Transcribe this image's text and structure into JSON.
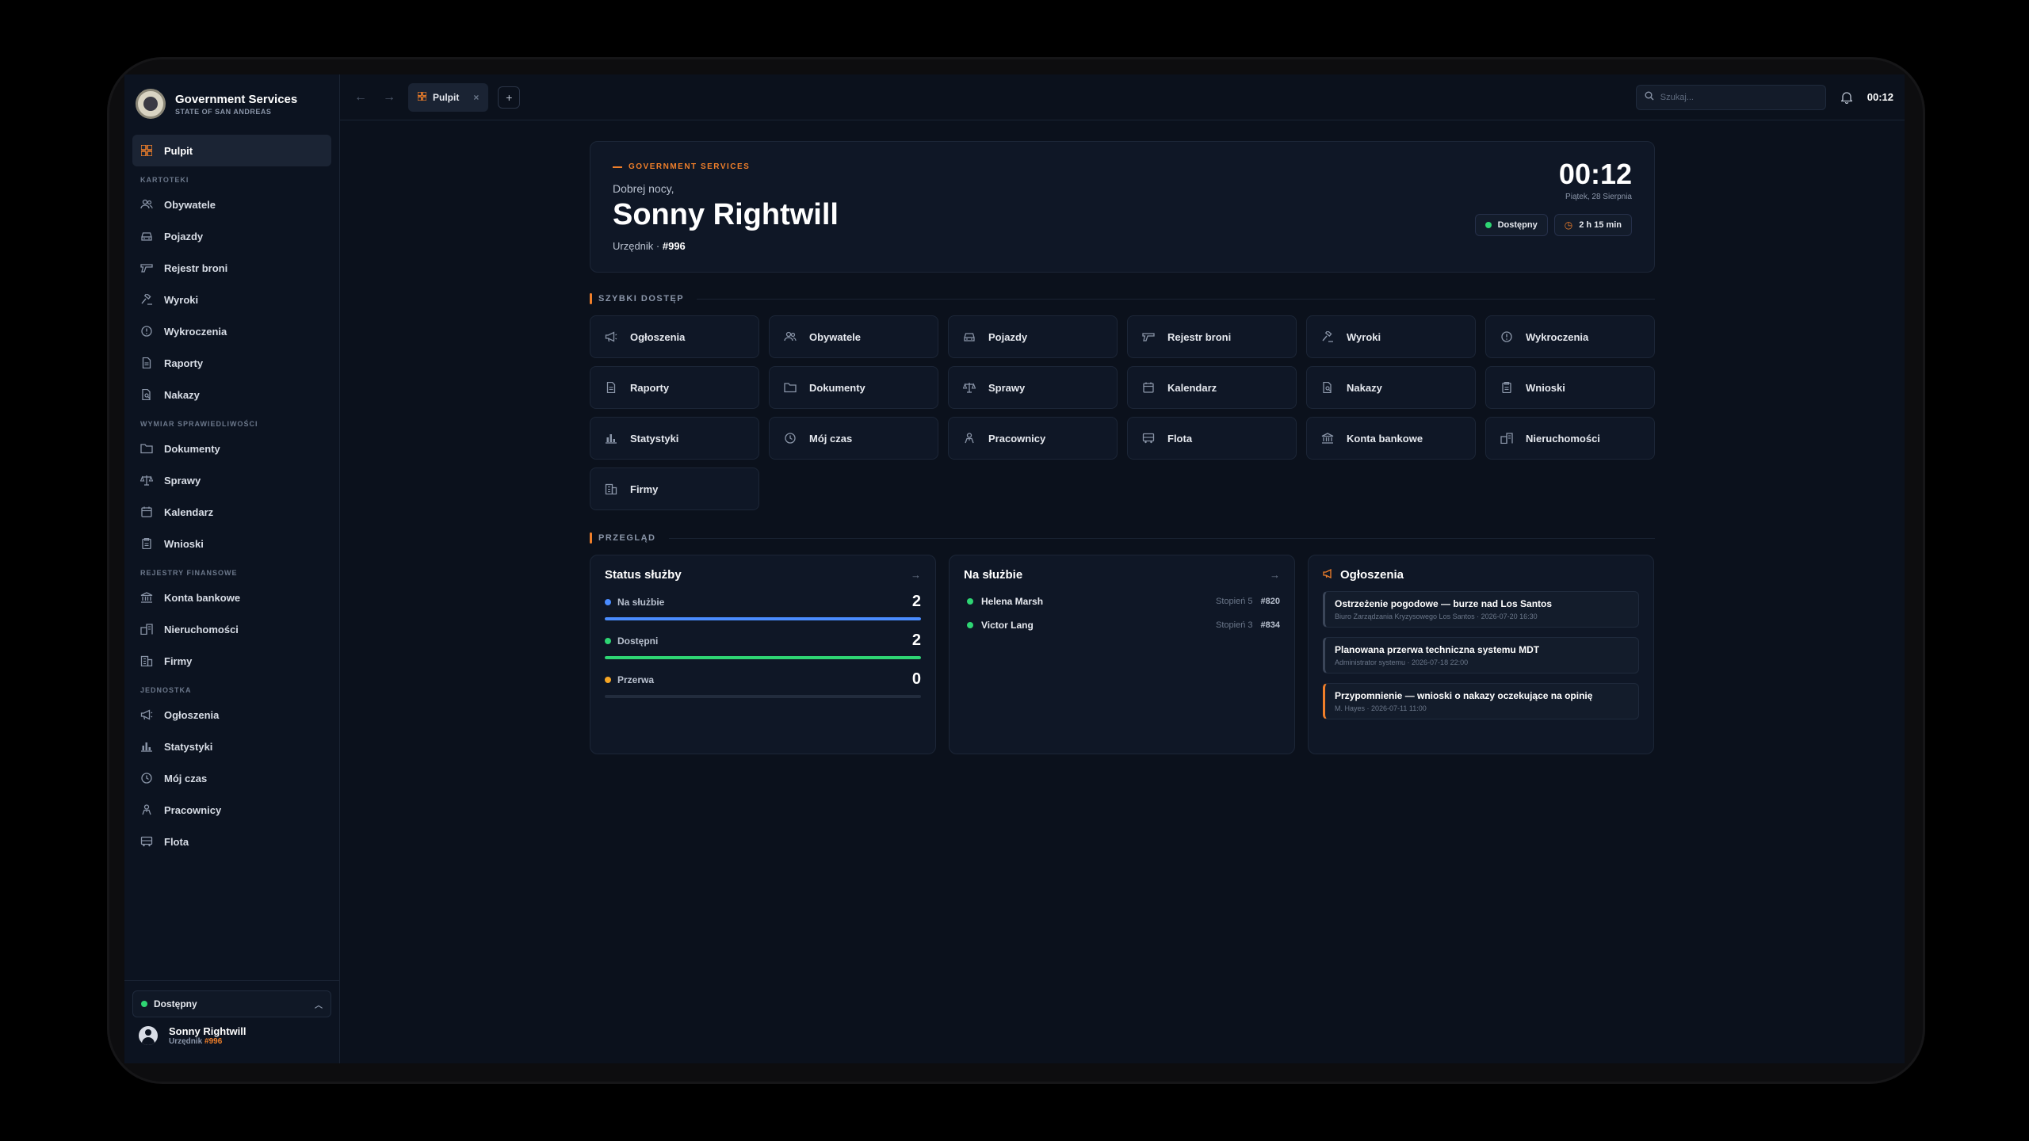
{
  "app": {
    "title": "Government Services",
    "subtitle": "STATE OF SAN ANDREAS"
  },
  "sidebar": {
    "active": {
      "label": "Pulpit",
      "icon": "grid-icon"
    },
    "sections": [
      {
        "label": "KARTOTEKI",
        "items": [
          {
            "label": "Obywatele",
            "icon": "users-icon"
          },
          {
            "label": "Pojazdy",
            "icon": "car-icon"
          },
          {
            "label": "Rejestr broni",
            "icon": "gun-icon"
          },
          {
            "label": "Wyroki",
            "icon": "gavel-icon"
          },
          {
            "label": "Wykroczenia",
            "icon": "alert-circle-icon"
          },
          {
            "label": "Raporty",
            "icon": "file-icon"
          },
          {
            "label": "Nakazy",
            "icon": "file-search-icon"
          }
        ]
      },
      {
        "label": "WYMIAR SPRAWIEDLIWOŚCI",
        "items": [
          {
            "label": "Dokumenty",
            "icon": "folder-icon"
          },
          {
            "label": "Sprawy",
            "icon": "scale-icon"
          },
          {
            "label": "Kalendarz",
            "icon": "calendar-icon"
          },
          {
            "label": "Wnioski",
            "icon": "clipboard-icon"
          }
        ]
      },
      {
        "label": "REJESTRY FINANSOWE",
        "items": [
          {
            "label": "Konta bankowe",
            "icon": "bank-icon"
          },
          {
            "label": "Nieruchomości",
            "icon": "property-icon"
          },
          {
            "label": "Firmy",
            "icon": "building-icon"
          }
        ]
      },
      {
        "label": "JEDNOSTKA",
        "items": [
          {
            "label": "Ogłoszenia",
            "icon": "megaphone-icon"
          },
          {
            "label": "Statystyki",
            "icon": "bar-chart-icon"
          },
          {
            "label": "Mój czas",
            "icon": "clock-icon"
          },
          {
            "label": "Pracownicy",
            "icon": "user-icon"
          },
          {
            "label": "Flota",
            "icon": "fleet-icon"
          }
        ]
      }
    ],
    "status": "Dostępny",
    "user": {
      "name": "Sonny Rightwill",
      "role": "Urzędnik",
      "badge": "#996"
    }
  },
  "topbar": {
    "tab_label": "Pulpit",
    "search_placeholder": "Szukaj...",
    "clock": "00:12"
  },
  "hero": {
    "eyebrow": "GOVERNMENT SERVICES",
    "greeting": "Dobrej nocy,",
    "name": "Sonny Rightwill",
    "role": "Urzędnik",
    "badge": "#996",
    "clock": "00:12",
    "date": "Piątek, 28 Sierpnia",
    "status_chip": "Dostępny",
    "time_chip": "2 h 15 min"
  },
  "quick_access": {
    "title": "SZYBKI DOSTĘP",
    "items": [
      {
        "label": "Ogłoszenia",
        "icon": "megaphone-icon"
      },
      {
        "label": "Obywatele",
        "icon": "users-icon"
      },
      {
        "label": "Pojazdy",
        "icon": "car-icon"
      },
      {
        "label": "Rejestr broni",
        "icon": "gun-icon"
      },
      {
        "label": "Wyroki",
        "icon": "gavel-icon"
      },
      {
        "label": "Wykroczenia",
        "icon": "alert-circle-icon"
      },
      {
        "label": "Raporty",
        "icon": "file-icon"
      },
      {
        "label": "Dokumenty",
        "icon": "folder-icon"
      },
      {
        "label": "Sprawy",
        "icon": "scale-icon"
      },
      {
        "label": "Kalendarz",
        "icon": "calendar-icon"
      },
      {
        "label": "Nakazy",
        "icon": "file-search-icon"
      },
      {
        "label": "Wnioski",
        "icon": "clipboard-icon"
      },
      {
        "label": "Statystyki",
        "icon": "bar-chart-icon"
      },
      {
        "label": "Mój czas",
        "icon": "clock-icon"
      },
      {
        "label": "Pracownicy",
        "icon": "user-icon"
      },
      {
        "label": "Flota",
        "icon": "fleet-icon"
      },
      {
        "label": "Konta bankowe",
        "icon": "bank-icon"
      },
      {
        "label": "Nieruchomości",
        "icon": "property-icon"
      },
      {
        "label": "Firmy",
        "icon": "building-icon"
      }
    ]
  },
  "overview": {
    "title": "PRZEGLĄD",
    "service_status": {
      "title": "Status służby",
      "rows": [
        {
          "label": "Na służbie",
          "value": "2",
          "fill": 1.0,
          "color": "#4a8cff"
        },
        {
          "label": "Dostępni",
          "value": "2",
          "fill": 1.0,
          "color": "#2ed573"
        },
        {
          "label": "Przerwa",
          "value": "0",
          "fill": 0.0,
          "color": "#f5a524"
        }
      ]
    },
    "on_duty": {
      "title": "Na służbie",
      "rows": [
        {
          "name": "Helena Marsh",
          "rank": "Stopień 5",
          "badge": "#820"
        },
        {
          "name": "Victor Lang",
          "rank": "Stopień 3",
          "badge": "#834"
        }
      ]
    },
    "announcements": {
      "title": "Ogłoszenia",
      "items": [
        {
          "title": "Ostrzeżenie pogodowe — burze nad Los Santos",
          "author": "Biuro Zarządzania Kryzysowego Los Santos",
          "date": "2026-07-20 16:30"
        },
        {
          "title": "Planowana przerwa techniczna systemu MDT",
          "author": "Administrator systemu",
          "date": "2026-07-18 22:00"
        },
        {
          "title": "Przypomnienie — wnioski o nakazy oczekujące na opinię",
          "author": "M. Hayes",
          "date": "2026-07-11 11:00"
        }
      ]
    }
  }
}
